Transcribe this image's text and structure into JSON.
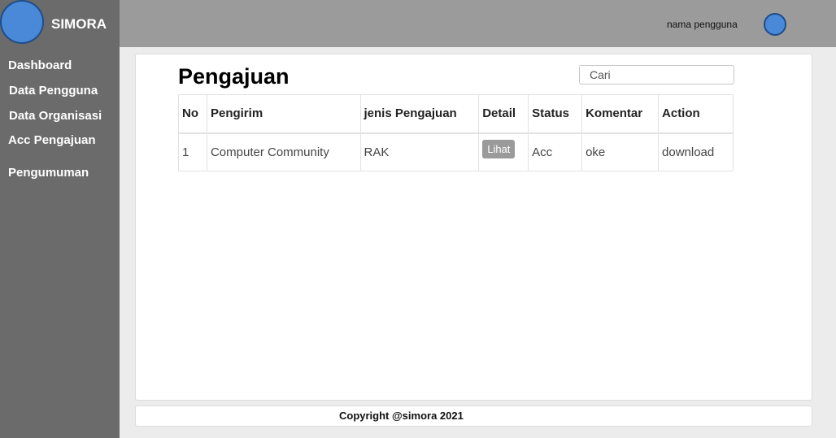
{
  "brand": {
    "name": "SIMORA"
  },
  "sidebar": {
    "items": [
      {
        "label": "Dashboard"
      },
      {
        "label": "Data Pengguna"
      },
      {
        "label": "Data Organisasi"
      },
      {
        "label": "Acc Pengajuan"
      },
      {
        "label": "Pengumuman"
      }
    ]
  },
  "header": {
    "user_name": "nama pengguna"
  },
  "main": {
    "title": "Pengajuan",
    "search": {
      "placeholder": "Cari",
      "value": ""
    },
    "table": {
      "columns": [
        "No",
        "Pengirim",
        "jenis Pengajuan",
        "Detail",
        "Status",
        "Komentar",
        "Action"
      ],
      "rows": [
        {
          "no": "1",
          "pengirim": "Computer Community",
          "jenis": "RAK",
          "detail_label": "Lihat",
          "status": "Acc",
          "komentar": "oke",
          "action": "download"
        }
      ]
    }
  },
  "footer": {
    "text": "Copyright @simora 2021"
  },
  "colors": {
    "sidebar": "#6b6b6b",
    "topbar": "#9b9b9b",
    "accent": "#4a88d8",
    "button": "#9a9a9a"
  }
}
